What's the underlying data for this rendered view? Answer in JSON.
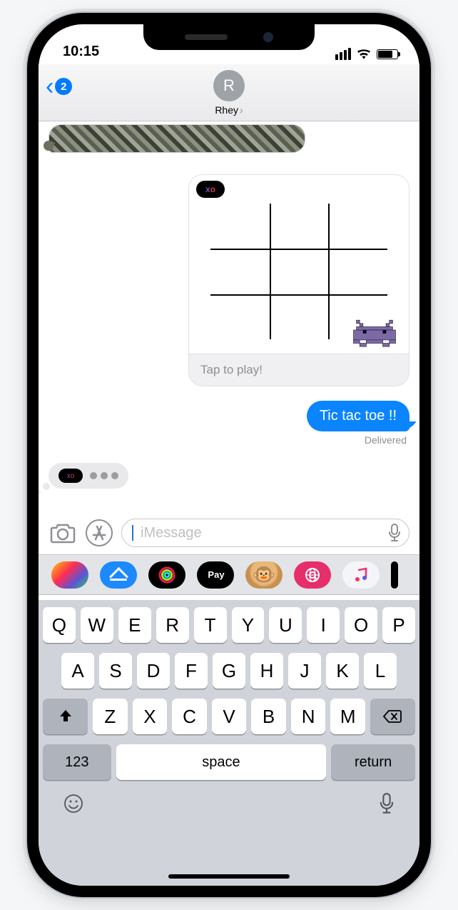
{
  "status": {
    "time": "10:15"
  },
  "nav": {
    "back_badge": "2",
    "contact_initial": "R",
    "contact_name": "Rhey"
  },
  "game_bubble": {
    "caption": "Tap to play!"
  },
  "messages": {
    "outgoing_1": "Tic tac toe !!",
    "delivered_label": "Delivered"
  },
  "input": {
    "placeholder": "iMessage"
  },
  "app_tray": {
    "apple_pay_label": "Pay"
  },
  "keyboard": {
    "row1": [
      "Q",
      "W",
      "E",
      "R",
      "T",
      "Y",
      "U",
      "I",
      "O",
      "P"
    ],
    "row2": [
      "A",
      "S",
      "D",
      "F",
      "G",
      "H",
      "J",
      "K",
      "L"
    ],
    "row3": [
      "Z",
      "X",
      "C",
      "V",
      "B",
      "N",
      "M"
    ],
    "num_label": "123",
    "space_label": "space",
    "return_label": "return"
  }
}
